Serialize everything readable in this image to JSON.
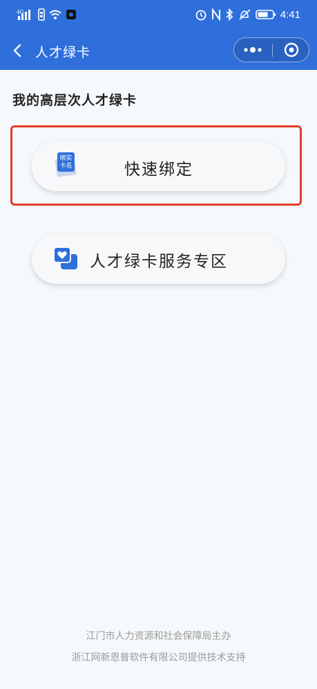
{
  "status_bar": {
    "signal_text": "4G",
    "time": "4:41",
    "icons": [
      "signal-icon",
      "wifi-icon",
      "app-notification-icon",
      "alarm-icon",
      "nfc-icon",
      "bluetooth-icon",
      "mute-icon",
      "battery-icon"
    ],
    "battery_level": 0.7
  },
  "nav": {
    "title": "人才绿卡",
    "back_icon": "chevron-left-icon",
    "more_icon": "more-dots-icon",
    "close_icon": "mini-program-close-icon"
  },
  "main": {
    "section_title": "我的高层次人才绿卡",
    "buttons": [
      {
        "label": "快速绑定",
        "icon": "realname-card-icon",
        "icon_text_line1": "绑实",
        "icon_text_line2": "卡名"
      },
      {
        "label": "人才绿卡服务专区",
        "icon": "heart-cards-icon"
      }
    ]
  },
  "footer": {
    "line1": "江门市人力资源和社会保障局主办",
    "line2": "浙江网新恩普软件有限公司提供技术支持"
  },
  "colors": {
    "header_bg": "#2f6fdc",
    "highlight_border": "#e23d2a",
    "page_bg": "#f6f9fb",
    "icon_blue": "#2f6fdc"
  }
}
